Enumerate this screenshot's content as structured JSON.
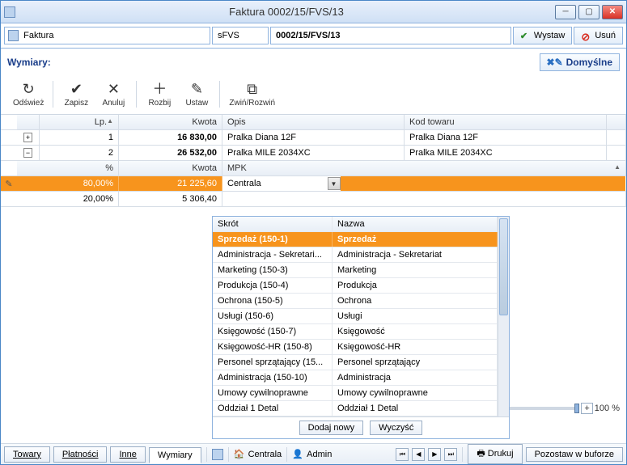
{
  "window": {
    "title": "Faktura 0002/15/FVS/13"
  },
  "header": {
    "doc_type": "Faktura",
    "series": "sFVS",
    "number": "0002/15/FVS/13",
    "issue_label": "Wystaw",
    "delete_label": "Usuń"
  },
  "section": {
    "label": "Wymiary:",
    "default_btn": "Domyślne"
  },
  "toolbar": {
    "refresh": "Odśwież",
    "save": "Zapisz",
    "cancel": "Anuluj",
    "split": "Rozbij",
    "set": "Ustaw",
    "collapse": "Zwiń/Rozwiń"
  },
  "grid": {
    "columns": {
      "lp": "Lp.",
      "kwota": "Kwota",
      "opis": "Opis",
      "kod": "Kod towaru"
    },
    "rows": [
      {
        "lp": "1",
        "kwota": "16 830,00",
        "opis": "Pralka Diana 12F",
        "kod": "Pralka Diana 12F",
        "expand": "+"
      },
      {
        "lp": "2",
        "kwota": "26 532,00",
        "opis": "Pralka MILE 2034XC",
        "kod": "Pralka MILE 2034XC",
        "expand": "−"
      }
    ],
    "subcolumns": {
      "pct": "%",
      "kwota": "Kwota",
      "mpk": "MPK"
    },
    "subrows": [
      {
        "pct": "80,00%",
        "kwota": "21 225,60",
        "mpk": "Centrala",
        "active": true
      },
      {
        "pct": "20,00%",
        "kwota": "5 306,40",
        "mpk": ""
      }
    ]
  },
  "dropdown": {
    "columns": {
      "skrot": "Skrót",
      "nazwa": "Nazwa"
    },
    "items": [
      {
        "skrot": "Sprzedaż (150-1)",
        "nazwa": "Sprzedaż",
        "selected": true
      },
      {
        "skrot": "Administracja - Sekretari...",
        "nazwa": "Administracja - Sekretariat"
      },
      {
        "skrot": "Marketing (150-3)",
        "nazwa": "Marketing"
      },
      {
        "skrot": "Produkcja (150-4)",
        "nazwa": "Produkcja"
      },
      {
        "skrot": "Ochrona (150-5)",
        "nazwa": "Ochrona"
      },
      {
        "skrot": "Usługi (150-6)",
        "nazwa": "Usługi"
      },
      {
        "skrot": "Księgowość (150-7)",
        "nazwa": "Księgowość"
      },
      {
        "skrot": "Księgowość-HR (150-8)",
        "nazwa": "Księgowość-HR"
      },
      {
        "skrot": "Personel sprzątający (15...",
        "nazwa": "Personel sprzątający"
      },
      {
        "skrot": "Administracja (150-10)",
        "nazwa": "Administracja"
      },
      {
        "skrot": "Umowy cywilnoprawne",
        "nazwa": "Umowy cywilnoprawne"
      },
      {
        "skrot": "Oddział 1 Detal",
        "nazwa": "Oddział 1 Detal"
      }
    ],
    "add_label": "Dodaj nowy",
    "clear_label": "Wyczyść"
  },
  "zoom": {
    "value": "100 %"
  },
  "footer": {
    "tabs": {
      "towary": "Towary",
      "platnosci": "Płatności",
      "inne": "Inne",
      "wymiary": "Wymiary"
    },
    "org": "Centrala",
    "user": "Admin",
    "print": "Drukuj",
    "buffer": "Pozostaw w buforze"
  }
}
